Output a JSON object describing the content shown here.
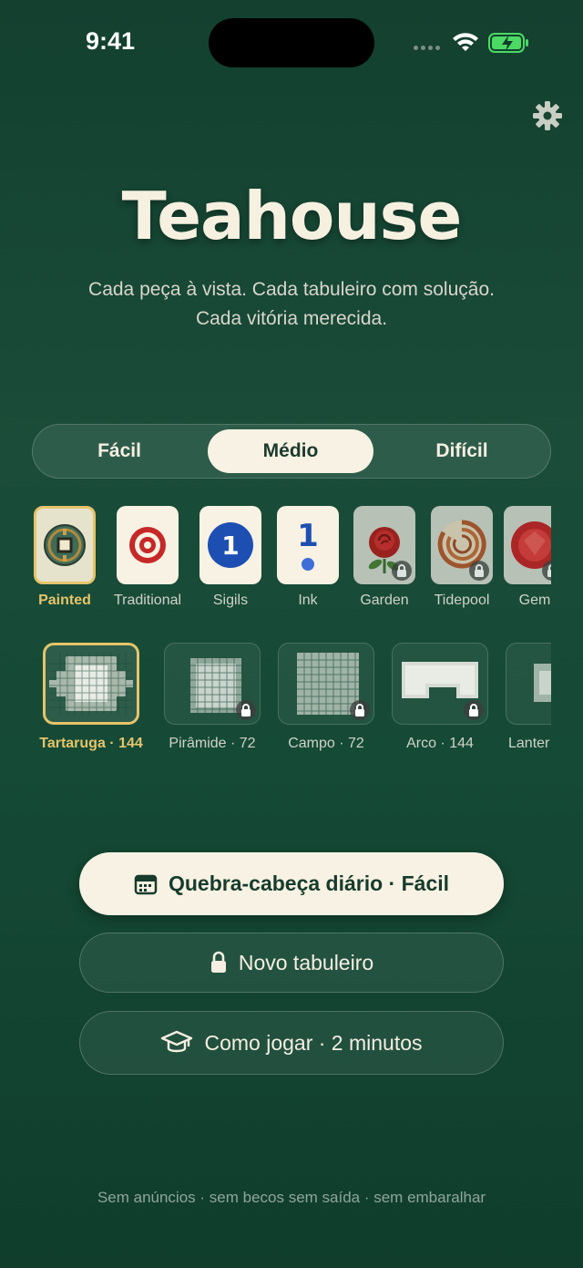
{
  "status": {
    "time": "9:41"
  },
  "header": {
    "title": "Teahouse",
    "subtitle_line1": "Cada peça à vista. Cada tabuleiro com solução.",
    "subtitle_line2": "Cada vitória merecida."
  },
  "difficulty": {
    "options": [
      "Fácil",
      "Médio",
      "Difícil"
    ],
    "selected": "Médio"
  },
  "themes": [
    {
      "label": "Painted",
      "selected": true,
      "locked": false,
      "icon": "bronze-coin-icon"
    },
    {
      "label": "Traditional",
      "selected": false,
      "locked": false,
      "icon": "target-icon"
    },
    {
      "label": "Sigils",
      "selected": false,
      "locked": false,
      "icon": "blue-circle-one-icon",
      "glyph": "1"
    },
    {
      "label": "Ink",
      "selected": false,
      "locked": false,
      "icon": "ink-one-dot-icon",
      "glyph": "1"
    },
    {
      "label": "Garden",
      "selected": false,
      "locked": true,
      "icon": "rose-icon"
    },
    {
      "label": "Tidepool",
      "selected": false,
      "locked": true,
      "icon": "nautilus-shell-icon"
    },
    {
      "label": "Gem",
      "selected": false,
      "locked": true,
      "icon": "red-gem-icon"
    }
  ],
  "layouts": [
    {
      "label": "Tartaruga · 144",
      "selected": true,
      "locked": false
    },
    {
      "label": "Pirâmide · 72",
      "selected": false,
      "locked": true
    },
    {
      "label": "Campo · 72",
      "selected": false,
      "locked": true
    },
    {
      "label": "Arco · 144",
      "selected": false,
      "locked": true
    },
    {
      "label": "Lanter",
      "selected": false,
      "locked": false
    }
  ],
  "actions": {
    "daily": "Quebra-cabeça diário · Fácil",
    "new_board": "Novo tabuleiro",
    "how_to": "Como jogar · 2 minutos"
  },
  "footer": "Sem anúncios · sem becos sem saída · sem embaralhar",
  "colors": {
    "accent": "#e5c46b",
    "cream": "#f7f2e3",
    "background": "#174a37"
  }
}
